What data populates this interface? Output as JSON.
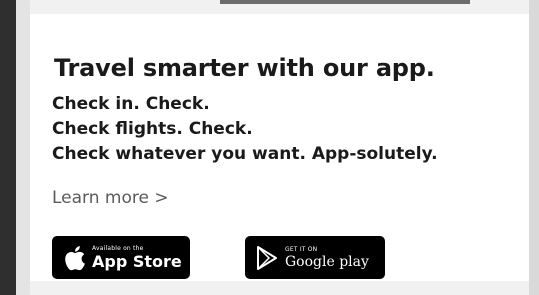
{
  "promo": {
    "headline": "Travel smarter with our app.",
    "lines": [
      "Check in. Check.",
      "Check flights. Check.",
      "Check whatever you want. App-solutely."
    ],
    "learn_more": "Learn more >"
  },
  "badges": {
    "appstore": {
      "small": "Available on the",
      "big": "App Store",
      "icon": "apple-icon"
    },
    "googleplay": {
      "small": "GET IT ON",
      "big": "Google play",
      "icon": "play-icon"
    }
  },
  "colors": {
    "text": "#1a1a1a",
    "link": "#5a5a5a",
    "badge_bg": "#000000",
    "badge_text": "#ffffff"
  }
}
